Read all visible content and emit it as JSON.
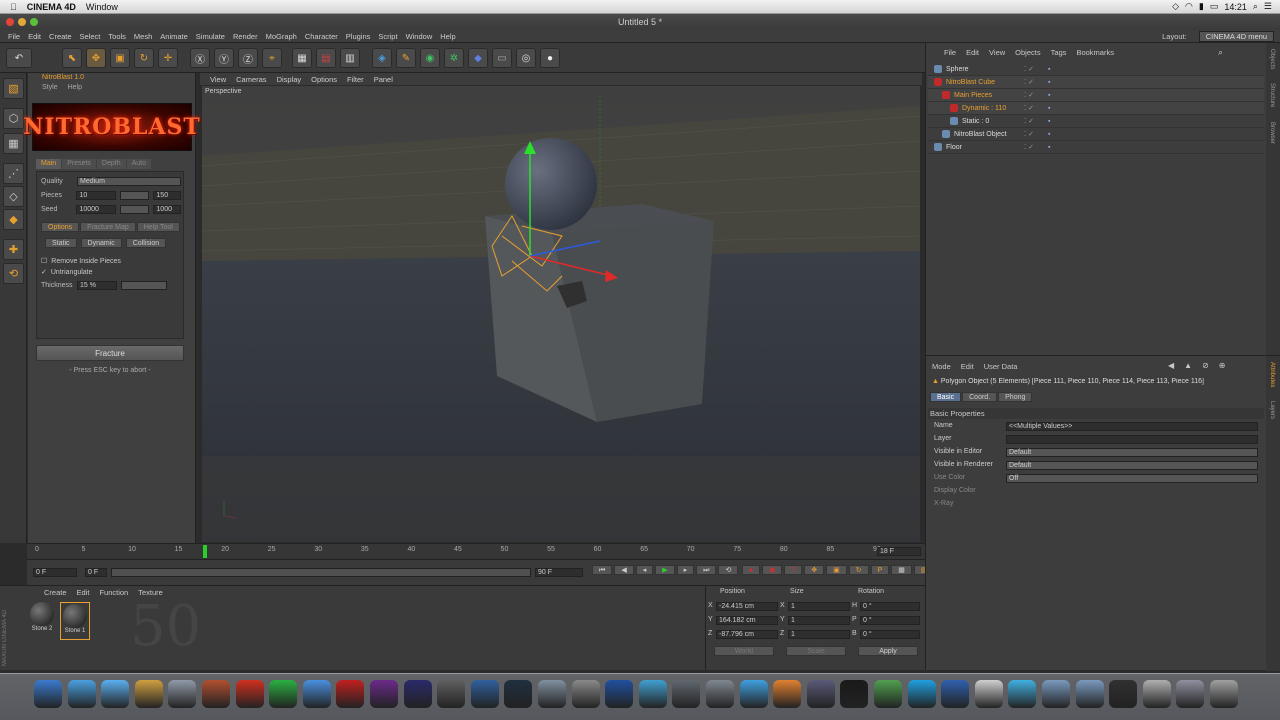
{
  "mac_menubar": {
    "app": "CINEMA 4D",
    "window": "Window",
    "time": "14:21",
    "icons": [
      "apple-icon",
      "dropbox-icon",
      "wifi-icon",
      "flag-icon",
      "battery-icon",
      "search-icon",
      "list-icon"
    ]
  },
  "window_title": "Untitled 5 *",
  "c4d_menu": [
    "File",
    "Edit",
    "Create",
    "Select",
    "Tools",
    "Mesh",
    "Animate",
    "Simulate",
    "Render",
    "MoGraph",
    "Character",
    "Plugins",
    "Script",
    "Window",
    "Help"
  ],
  "layout": {
    "label": "Layout:",
    "value": "CINEMA 4D menu"
  },
  "nitroblast": {
    "title": "NitroBlast 1.0",
    "menu": [
      "Style",
      "Help"
    ],
    "logo": "NITROBLAST",
    "tabs": [
      "Main",
      "Presets",
      "Depth",
      "Auto"
    ],
    "quality": {
      "label": "Quality",
      "value": "Medium"
    },
    "pieces": {
      "label": "Pieces",
      "value": "10",
      "max": "150"
    },
    "seed": {
      "label": "Seed",
      "value": "10000",
      "max": "1000"
    },
    "subtabs": [
      "Options",
      "Fracture Map",
      "Help Tool"
    ],
    "types": [
      "Static",
      "Dynamic",
      "Collision"
    ],
    "check1": "Remove Inside Pieces",
    "check2": "Untriangulate",
    "thickness": {
      "label": "Thickness",
      "value": "15 %"
    },
    "fracture_btn": "Fracture",
    "hint": "- Press ESC key to abort -"
  },
  "viewport_menu": [
    "View",
    "Cameras",
    "Display",
    "Options",
    "Filter",
    "Panel"
  ],
  "viewport_label": "Perspective",
  "timeline": {
    "ticks": [
      "0",
      "5",
      "10",
      "15",
      "20",
      "25",
      "30",
      "35",
      "40",
      "45",
      "50",
      "55",
      "60",
      "65",
      "70",
      "75",
      "80",
      "85",
      "90"
    ],
    "current": "18 F",
    "start": "0 F",
    "end": "90 F",
    "min": "0 F",
    "playhead": 18
  },
  "materials": {
    "menu": [
      "Create",
      "Edit",
      "Function",
      "Texture"
    ],
    "items": [
      "Stone 2",
      "Stone 1"
    ],
    "brand": "MAXON CINEMA 4D"
  },
  "coords": {
    "headers": [
      "Position",
      "Size",
      "Rotation"
    ],
    "rows": [
      {
        "axis": "X",
        "pos": "-24.415 cm",
        "size": "1",
        "rlabel": "H",
        "rot": "0 °"
      },
      {
        "axis": "Y",
        "pos": "164.182 cm",
        "size": "1",
        "rlabel": "P",
        "rot": "0 °"
      },
      {
        "axis": "Z",
        "pos": "-87.796 cm",
        "size": "1",
        "rlabel": "B",
        "rot": "0 °"
      }
    ],
    "mode1": "World",
    "mode2": "Scale",
    "apply": "Apply"
  },
  "objects": {
    "menu": [
      "File",
      "Edit",
      "View",
      "Objects",
      "Tags",
      "Bookmarks"
    ],
    "items": [
      {
        "name": "Sphere",
        "indent": 0,
        "color": "#ddd"
      },
      {
        "name": "NitroBlast Cube",
        "indent": 0,
        "color": "#e8a030"
      },
      {
        "name": "Main Pieces",
        "indent": 1,
        "color": "#e8a030"
      },
      {
        "name": "Dynamic : 110",
        "indent": 2,
        "color": "#e8a030"
      },
      {
        "name": "Static : 0",
        "indent": 2,
        "color": "#ddd"
      },
      {
        "name": "NitroBlast Object",
        "indent": 1,
        "color": "#ddd"
      },
      {
        "name": "Floor",
        "indent": 0,
        "color": "#ddd"
      }
    ],
    "side_tabs": [
      "Objects",
      "Structure",
      "Browser"
    ]
  },
  "attributes": {
    "menu": [
      "Mode",
      "Edit",
      "User Data"
    ],
    "title": "Polygon Object (5 Elements) [Piece 111, Piece 110, Piece 114, Piece 113, Piece 116]",
    "tabs": [
      "Basic",
      "Coord.",
      "Phong"
    ],
    "section": "Basic Properties",
    "rows": [
      {
        "label": "Name",
        "value": "<<Multiple Values>>"
      },
      {
        "label": "Layer",
        "value": ""
      },
      {
        "label": "Visible in Editor",
        "value": "Default"
      },
      {
        "label": "Visible in Renderer",
        "value": "Default"
      },
      {
        "label": "Use Color",
        "value": "Off"
      },
      {
        "label": "Display Color",
        "value": ""
      },
      {
        "label": "X-Ray",
        "value": ""
      }
    ],
    "side_tabs": [
      "Attributes",
      "Layers"
    ]
  },
  "dock_icons": [
    "finder-icon",
    "safari-icon",
    "appstore-icon",
    "preview-icon",
    "photobooth-icon",
    "photos-icon",
    "sketchbook-icon",
    "spotify-icon",
    "itunes-icon",
    "flash-icon",
    "premiere-icon",
    "aftereffects-icon",
    "finalcut-icon",
    "blender-icon",
    "cinema4d-icon",
    "iphoto-icon",
    "instruments-icon",
    "realflow-icon",
    "dropzone-icon",
    "network-icon",
    "util-icon",
    "wunderlist-icon",
    "vpn-icon",
    "pencil-icon",
    "terminal-icon",
    "motion-icon",
    "skype-icon",
    "photoshop-icon",
    "browser-icon",
    "maps-icon",
    "folder-icon",
    "folder2-icon",
    "music-icon",
    "avatar-icon",
    "printer-icon",
    "trash-icon"
  ],
  "colors": {
    "accent": "#e8a030",
    "panel": "#3d3d3d",
    "dark": "#2b2b2b"
  }
}
